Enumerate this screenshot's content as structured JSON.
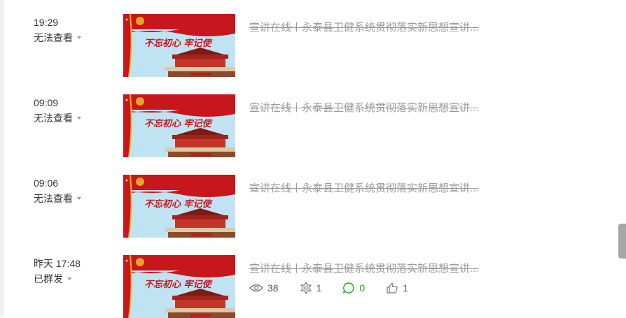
{
  "items": [
    {
      "time": "19:29",
      "status": "无法查看",
      "title": "宣讲在线丨永泰县卫健系统贯彻落实新思想宣讲...",
      "banner_text": "不忘初心 牢记使",
      "show_stats": false
    },
    {
      "time": "09:09",
      "status": "无法查看",
      "title": "宣讲在线丨永泰县卫健系统贯彻落实新思想宣讲...",
      "banner_text": "不忘初心 牢记使",
      "show_stats": false
    },
    {
      "time": "09:06",
      "status": "无法查看",
      "title": "宣讲在线丨永泰县卫健系统贯彻落实新思想宣讲...",
      "banner_text": "不忘初心 牢记使",
      "show_stats": false
    },
    {
      "time": "昨天 17:48",
      "status": "已群发",
      "title": "宣讲在线丨永泰县卫健系统贯彻落实新思想宣讲...",
      "banner_text": "不忘初心 牢记使",
      "show_stats": true,
      "stats": {
        "views": "38",
        "shares": "1",
        "comments": "0",
        "likes": "1"
      }
    }
  ],
  "icons": {
    "views": "eye-icon",
    "shares": "share-icon",
    "comments": "comment-icon",
    "likes": "thumbs-up-icon",
    "status": "chevron-down-icon"
  },
  "colors": {
    "title_struck": "#9b9b9b",
    "comment_green": "#1aad19",
    "banner_red": "#c8161d",
    "sky_blue": "#bfe3f3",
    "gold": "#e8b32a"
  }
}
